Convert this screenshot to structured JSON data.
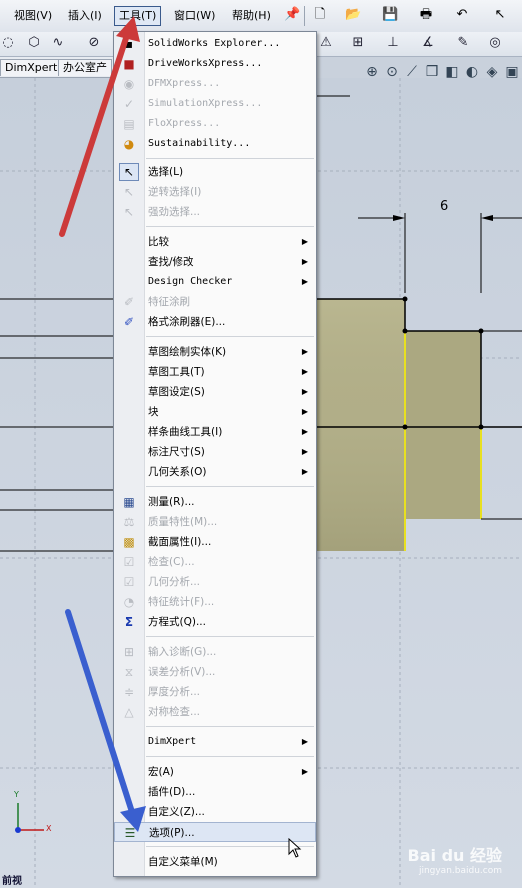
{
  "menubar": {
    "items": [
      {
        "label": "视图(V)"
      },
      {
        "label": "插入(I)"
      },
      {
        "label": "工具(T)"
      },
      {
        "label": "窗口(W)"
      },
      {
        "label": "帮助(H)"
      }
    ]
  },
  "tabs": [
    "DimXpert",
    "办公室产"
  ],
  "canvas": {
    "dimension_value": "6",
    "view_label": "前视",
    "axis_x": "X",
    "axis_y": "Y"
  },
  "menu": {
    "items": [
      {
        "label": "SolidWorks Explorer...",
        "icon": "explorer-icon",
        "enabled": true
      },
      {
        "label": "DriveWorksXpress...",
        "icon": "driveworks-icon",
        "enabled": true
      },
      {
        "label": "DFMXpress...",
        "icon": "dfm-icon",
        "enabled": false
      },
      {
        "label": "SimulationXpress...",
        "icon": "simulation-icon",
        "enabled": false
      },
      {
        "label": "FloXpress...",
        "icon": "flo-icon",
        "enabled": false
      },
      {
        "label": "Sustainability...",
        "icon": "sustainability-icon",
        "enabled": true
      },
      {
        "label": "选择(L)",
        "icon": "select-cursor-icon",
        "enabled": true
      },
      {
        "label": "逆转选择(I)",
        "icon": "reverse-select-icon",
        "enabled": false
      },
      {
        "label": "强劲选择...",
        "icon": "power-select-icon",
        "enabled": false
      },
      {
        "label": "比较",
        "submenu": true,
        "enabled": true
      },
      {
        "label": "查找/修改",
        "submenu": true,
        "enabled": true
      },
      {
        "label": "Design Checker",
        "submenu": true,
        "enabled": true
      },
      {
        "label": "特征涂刷",
        "icon": "feature-paint-icon",
        "enabled": false
      },
      {
        "label": "格式涂刷器(E)...",
        "icon": "format-painter-icon",
        "enabled": true
      },
      {
        "label": "草图绘制实体(K)",
        "submenu": true,
        "enabled": true
      },
      {
        "label": "草图工具(T)",
        "submenu": true,
        "enabled": true
      },
      {
        "label": "草图设定(S)",
        "submenu": true,
        "enabled": true
      },
      {
        "label": "块",
        "submenu": true,
        "enabled": true
      },
      {
        "label": "样条曲线工具(I)",
        "submenu": true,
        "enabled": true
      },
      {
        "label": "标注尺寸(S)",
        "submenu": true,
        "enabled": true
      },
      {
        "label": "几何关系(O)",
        "submenu": true,
        "enabled": true
      },
      {
        "label": "测量(R)...",
        "icon": "measure-icon",
        "enabled": true
      },
      {
        "label": "质量特性(M)...",
        "icon": "mass-properties-icon",
        "enabled": false
      },
      {
        "label": "截面属性(I)...",
        "icon": "section-properties-icon",
        "enabled": true
      },
      {
        "label": "检查(C)...",
        "icon": "check-icon",
        "enabled": false
      },
      {
        "label": "几何分析...",
        "icon": "geometry-analysis-icon",
        "enabled": false
      },
      {
        "label": "特征统计(F)...",
        "icon": "feature-stats-icon",
        "enabled": false
      },
      {
        "label": "方程式(Q)...",
        "icon": "sigma-icon",
        "enabled": true
      },
      {
        "label": "输入诊断(G)...",
        "icon": "import-diagnostics-icon",
        "enabled": false
      },
      {
        "label": "误差分析(V)...",
        "icon": "deviation-analysis-icon",
        "enabled": false
      },
      {
        "label": "厚度分析...",
        "icon": "thickness-analysis-icon",
        "enabled": false
      },
      {
        "label": "对称检查...",
        "icon": "symmetry-check-icon",
        "enabled": false
      },
      {
        "label": "DimXpert",
        "submenu": true,
        "enabled": true
      },
      {
        "label": "宏(A)",
        "submenu": true,
        "enabled": true
      },
      {
        "label": "插件(D)...",
        "enabled": true
      },
      {
        "label": "自定义(Z)...",
        "enabled": true
      },
      {
        "label": "选项(P)...",
        "icon": "options-icon",
        "enabled": true,
        "highlighted": true
      },
      {
        "label": "自定义菜单(M)",
        "enabled": true
      }
    ]
  },
  "watermark": {
    "brand": "Bai du 经验",
    "url": "jingyan.baidu.com"
  },
  "colors": {
    "menu_bg": "#fafafa",
    "part_fill": "#b3b08a",
    "highlight_edge": "#e8e020",
    "arrow_red": "#cc3a3a",
    "arrow_blue": "#3a5fcf"
  }
}
